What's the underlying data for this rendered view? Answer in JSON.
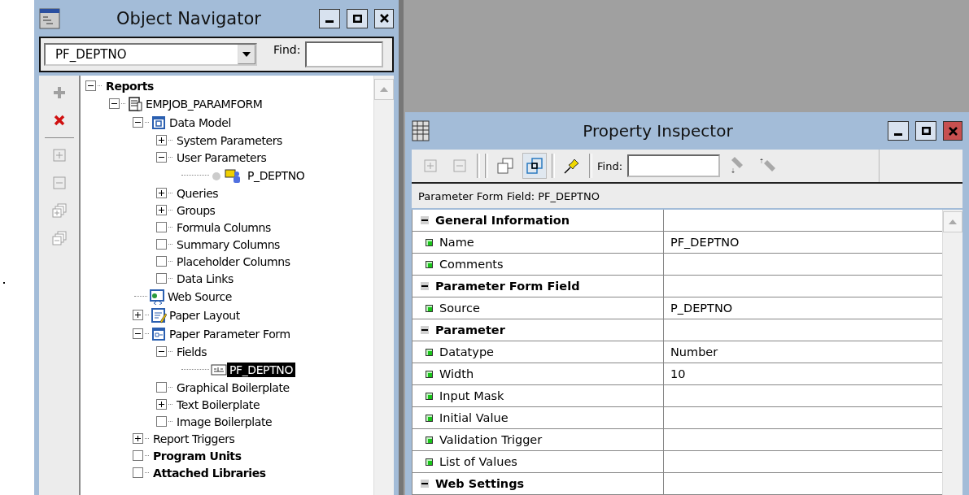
{
  "navigator": {
    "title": "Object Navigator",
    "window_buttons": [
      {
        "kind": "minimize"
      },
      {
        "kind": "maximize"
      },
      {
        "kind": "close"
      }
    ],
    "object_select": {
      "value": "PF_DEPTNO"
    },
    "find": {
      "label": "Find:"
    },
    "side_tools": [
      {
        "kind": "create",
        "disabled": true
      },
      {
        "kind": "delete",
        "disabled": false
      },
      {
        "kind": "separator"
      },
      {
        "kind": "expand",
        "disabled": true
      },
      {
        "kind": "collapse",
        "disabled": true
      },
      {
        "kind": "expand-all",
        "disabled": true
      },
      {
        "kind": "collapse-all",
        "disabled": true
      }
    ],
    "tree": [
      {
        "label": "Reports",
        "bold": true,
        "kind": "folder",
        "expanded": true,
        "selected": false,
        "children": [
          {
            "label": "EMPJOB_PARAMFORM",
            "kind": "report",
            "expanded": true,
            "selected": false,
            "children": [
              {
                "label": "Data Model",
                "kind": "data-model",
                "expanded": true,
                "selected": false,
                "children": [
                  {
                    "label": "System Parameters",
                    "kind": "folder",
                    "expanded": false,
                    "selected": false
                  },
                  {
                    "label": "User Parameters",
                    "kind": "folder",
                    "expanded": true,
                    "selected": false,
                    "children": [
                      {
                        "label": "P_DEPTNO",
                        "kind": "parameter",
                        "selected": false
                      }
                    ]
                  },
                  {
                    "label": "Queries",
                    "kind": "folder",
                    "expanded": false,
                    "selected": false
                  },
                  {
                    "label": "Groups",
                    "kind": "folder",
                    "expanded": false,
                    "selected": false
                  },
                  {
                    "label": "Formula Columns",
                    "kind": "empty",
                    "selected": false
                  },
                  {
                    "label": "Summary Columns",
                    "kind": "empty",
                    "selected": false
                  },
                  {
                    "label": "Placeholder Columns",
                    "kind": "empty",
                    "selected": false
                  },
                  {
                    "label": "Data Links",
                    "kind": "empty",
                    "selected": false
                  }
                ]
              },
              {
                "label": "Web Source",
                "kind": "web-source",
                "selected": false
              },
              {
                "label": "Paper Layout",
                "kind": "paper-layout",
                "expanded": false,
                "selected": false
              },
              {
                "label": "Paper Parameter Form",
                "kind": "param-form",
                "expanded": true,
                "selected": false,
                "children": [
                  {
                    "label": "Fields",
                    "kind": "folder",
                    "expanded": true,
                    "selected": false,
                    "children": [
                      {
                        "label": "PF_DEPTNO",
                        "kind": "field",
                        "selected": true
                      }
                    ]
                  },
                  {
                    "label": "Graphical Boilerplate",
                    "kind": "empty",
                    "selected": false
                  },
                  {
                    "label": "Text Boilerplate",
                    "kind": "folder",
                    "expanded": false,
                    "selected": false
                  },
                  {
                    "label": "Image Boilerplate",
                    "kind": "empty",
                    "selected": false
                  }
                ]
              },
              {
                "label": "Report Triggers",
                "kind": "folder",
                "expanded": false,
                "selected": false
              },
              {
                "label": "Program Units",
                "bold": true,
                "kind": "empty",
                "selected": false
              },
              {
                "label": "Attached Libraries",
                "bold": true,
                "kind": "empty",
                "selected": false
              }
            ]
          }
        ]
      }
    ]
  },
  "inspector": {
    "title": "Property Inspector",
    "window_buttons": [
      {
        "kind": "minimize"
      },
      {
        "kind": "maximize"
      },
      {
        "kind": "close"
      }
    ],
    "toolbar": [
      {
        "kind": "expand",
        "disabled": true
      },
      {
        "kind": "collapse",
        "disabled": true
      },
      {
        "kind": "separator"
      },
      {
        "kind": "separator"
      },
      {
        "kind": "union",
        "pressed": false
      },
      {
        "kind": "intersection",
        "pressed": true
      },
      {
        "kind": "separator"
      },
      {
        "kind": "pin"
      },
      {
        "kind": "separator"
      },
      {
        "kind": "find"
      },
      {
        "kind": "find-next",
        "disabled": true
      },
      {
        "kind": "find-previous",
        "disabled": true
      }
    ],
    "find": {
      "label": "Find:"
    },
    "subject": "Parameter Form Field: PF_DEPTNO",
    "sections": [
      {
        "name": "General Information",
        "expanded": true,
        "properties": [
          {
            "name": "Name",
            "value": "PF_DEPTNO"
          },
          {
            "name": "Comments"
          }
        ]
      },
      {
        "name": "Parameter Form Field",
        "expanded": true,
        "properties": [
          {
            "name": "Source",
            "value": "P_DEPTNO"
          }
        ]
      },
      {
        "name": "Parameter",
        "expanded": true,
        "properties": [
          {
            "name": "Datatype",
            "value": "Number"
          },
          {
            "name": "Width",
            "value": "10"
          },
          {
            "name": "Input Mask"
          },
          {
            "name": "Initial Value"
          },
          {
            "name": "Validation Trigger"
          },
          {
            "name": "List of Values"
          }
        ]
      },
      {
        "name": "Web Settings",
        "expanded": true
      }
    ]
  }
}
